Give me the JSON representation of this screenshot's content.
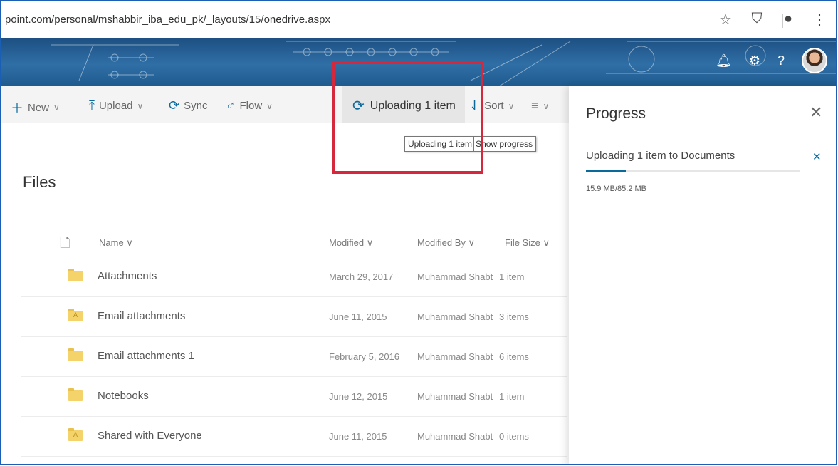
{
  "browser": {
    "url": "point.com/personal/mshabbir_iba_edu_pk/_layouts/15/onedrive.aspx",
    "icons": [
      "star-icon",
      "vpn-shield-icon",
      "account-icon",
      "menu-kebab-icon"
    ]
  },
  "commandbar": {
    "new_label": "New",
    "upload_label": "Upload",
    "sync_label": "Sync",
    "flow_label": "Flow",
    "uploading_label": "Uploading 1 item",
    "sort_label": "Sort"
  },
  "tooltip": {
    "text1": "Uploading 1 item",
    "text2": "Show progress"
  },
  "main": {
    "title": "Files",
    "columns": [
      "Name",
      "Modified",
      "Modified By",
      "File Size"
    ],
    "rows": [
      {
        "name": "Attachments",
        "modified": "March 29, 2017",
        "modified_by": "Muhammad Shabt",
        "size": "1 item"
      },
      {
        "name": "Email attachments",
        "modified": "June 11, 2015",
        "modified_by": "Muhammad Shabt",
        "size": "3 items"
      },
      {
        "name": "Email attachments 1",
        "modified": "February 5, 2016",
        "modified_by": "Muhammad Shabt",
        "size": "6 items"
      },
      {
        "name": "Notebooks",
        "modified": "June 12, 2015",
        "modified_by": "Muhammad Shabt",
        "size": "1 item"
      },
      {
        "name": "Shared with Everyone",
        "modified": "June 11, 2015",
        "modified_by": "Muhammad Shabt",
        "size": "0 items"
      }
    ]
  },
  "progress": {
    "title": "Progress",
    "item_text": "Uploading 1 item to Documents",
    "size_text": "15.9 MB/85.2 MB",
    "fraction": 0.187
  },
  "colors": {
    "accent": "#0b6a9c",
    "highlight": "#d6283c",
    "banner": "#2f6fa6"
  }
}
